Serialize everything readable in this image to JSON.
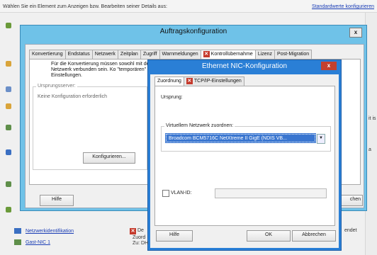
{
  "topbar": {
    "hint": "Wählen Sie ein Element zum Anzeigen bzw. Bearbeiten seiner Details aus:",
    "link": "Standardwerte konfigurieren"
  },
  "side_right": {
    "a": "it is",
    "b": "a",
    "c": "endet"
  },
  "main_window": {
    "title": "Auftragskonfiguration",
    "close": "x",
    "tabs": [
      "Konvertierung",
      "Endstatus",
      "Netzwerk",
      "Zeitplan",
      "Zugriff",
      "Warnmeldungen",
      "Kontrollübernahme",
      "Lizenz",
      "Post-Migration"
    ],
    "selected_tab": "Kontrollübernahme",
    "note": "Für die Konvertierung müssen sowohl mit dem Netzwerk verbunden sein. Ko \"temporären\" Einstellungen.",
    "group_title": "Ursprungsserver:",
    "group_empty": "Keine Konfiguration erforderlich",
    "configure_button": "Konfigurieren...",
    "help_button": "Hilfe",
    "right_button": "chen"
  },
  "nic_dialog": {
    "title": "Ethernet NIC-Konfiguration",
    "close": "x",
    "tabs": [
      "Zuordnung",
      "TCP/IP-Einstellungen"
    ],
    "origin_label": "Ursprung:",
    "virtual_group_label": "Virtuellem Netzwerk zuordnen:",
    "selected_network": "Broadcom BCM5716C NetXtreme II GigE (NDIS VB...",
    "vlan_label": "VLAN-ID:",
    "help_button": "Hilfe",
    "ok_button": "OK",
    "cancel_button": "Abbrechen"
  },
  "bottom_list": {
    "items": [
      "Netzwerkidentifikation",
      "Gast-NIC 1"
    ],
    "mid_1": "De",
    "mid_2a": "Zuord",
    "mid_2b": "Zu: DH"
  },
  "colors": {
    "window_frame": "#6fc2e8",
    "dialog_frame": "#2a7fd6",
    "dialog_close": "#c4402e",
    "selection": "#3a76d0",
    "link": "#1a3db5"
  }
}
